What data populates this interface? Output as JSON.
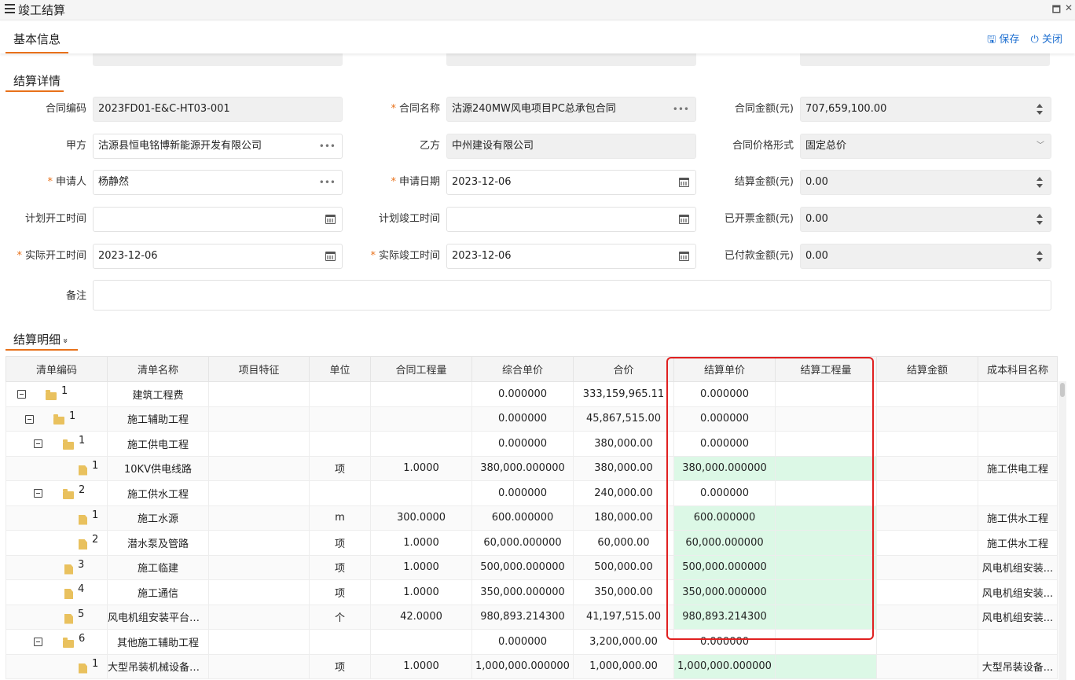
{
  "window": {
    "title": "竣工结算",
    "maximize_glyph": "🗖",
    "close_glyph": "✕"
  },
  "header": {
    "section": "基本信息",
    "save_label": "保存",
    "close_label": "关闭",
    "save_icon": "save-icon",
    "power_icon": "power-icon"
  },
  "details": {
    "section": "结算详情",
    "contract_code": {
      "label": "合同编码",
      "value": "2023FD01-E&C-HT03-001"
    },
    "contract_name": {
      "label": "合同名称",
      "value": "沽源240MW风电项目PC总承包合同"
    },
    "contract_amount": {
      "label": "合同金额(元)",
      "value": "707,659,100.00"
    },
    "party_a": {
      "label": "甲方",
      "value": "沽源县恒电铭博新能源开发有限公司"
    },
    "party_b": {
      "label": "乙方",
      "value": "中州建设有限公司"
    },
    "price_form": {
      "label": "合同价格形式",
      "value": "固定总价"
    },
    "applicant": {
      "label": "申请人",
      "value": "杨静然"
    },
    "apply_date": {
      "label": "申请日期",
      "value": "2023-12-06"
    },
    "settle_amount": {
      "label": "结算金额(元)",
      "value": "0.00"
    },
    "plan_start": {
      "label": "计划开工时间",
      "value": ""
    },
    "plan_end": {
      "label": "计划竣工时间",
      "value": ""
    },
    "invoiced_amount": {
      "label": "已开票金额(元)",
      "value": "0.00"
    },
    "actual_start": {
      "label": "实际开工时间",
      "value": "2023-12-06"
    },
    "actual_end": {
      "label": "实际竣工时间",
      "value": "2023-12-06"
    },
    "paid_amount": {
      "label": "已付款金额(元)",
      "value": "0.00"
    },
    "remark": {
      "label": "备注",
      "value": ""
    },
    "required_mark": "*",
    "dots": "•••"
  },
  "items": {
    "section": "结算明细",
    "chevron": "»",
    "columns": [
      "清单编码",
      "清单名称",
      "项目特征",
      "单位",
      "合同工程量",
      "综合单价",
      "合价",
      "结算单价",
      "结算工程量",
      "结算金额",
      "成本科目名称"
    ],
    "rows": [
      {
        "code": "1",
        "name": "建筑工程费",
        "feature": "",
        "unit": "",
        "qty": "",
        "price": "0.000000",
        "total": "333,159,965.11",
        "sprice": "0.000000",
        "sqty": "",
        "samt": "",
        "cost": ""
      },
      {
        "code": "1",
        "name": "施工辅助工程",
        "feature": "",
        "unit": "",
        "qty": "",
        "price": "0.000000",
        "total": "45,867,515.00",
        "sprice": "0.000000",
        "sqty": "",
        "samt": "",
        "cost": ""
      },
      {
        "code": "1",
        "name": "施工供电工程",
        "feature": "",
        "unit": "",
        "qty": "",
        "price": "0.000000",
        "total": "380,000.00",
        "sprice": "0.000000",
        "sqty": "",
        "samt": "",
        "cost": ""
      },
      {
        "code": "1",
        "name": "10KV供电线路",
        "feature": "",
        "unit": "项",
        "qty": "1.0000",
        "price": "380,000.000000",
        "total": "380,000.00",
        "sprice": "380,000.000000",
        "sqty": "",
        "samt": "",
        "cost": "施工供电工程"
      },
      {
        "code": "2",
        "name": "施工供水工程",
        "feature": "",
        "unit": "",
        "qty": "",
        "price": "0.000000",
        "total": "240,000.00",
        "sprice": "0.000000",
        "sqty": "",
        "samt": "",
        "cost": ""
      },
      {
        "code": "1",
        "name": "施工水源",
        "feature": "",
        "unit": "m",
        "qty": "300.0000",
        "price": "600.000000",
        "total": "180,000.00",
        "sprice": "600.000000",
        "sqty": "",
        "samt": "",
        "cost": "施工供水工程"
      },
      {
        "code": "2",
        "name": "潜水泵及管路",
        "feature": "",
        "unit": "项",
        "qty": "1.0000",
        "price": "60,000.000000",
        "total": "60,000.00",
        "sprice": "60,000.000000",
        "sqty": "",
        "samt": "",
        "cost": "施工供水工程"
      },
      {
        "code": "3",
        "name": "施工临建",
        "feature": "",
        "unit": "项",
        "qty": "1.0000",
        "price": "500,000.000000",
        "total": "500,000.00",
        "sprice": "500,000.000000",
        "sqty": "",
        "samt": "",
        "cost": "风电机组安装..."
      },
      {
        "code": "4",
        "name": "施工通信",
        "feature": "",
        "unit": "项",
        "qty": "1.0000",
        "price": "350,000.000000",
        "total": "350,000.00",
        "sprice": "350,000.000000",
        "sqty": "",
        "samt": "",
        "cost": "风电机组安装..."
      },
      {
        "code": "5",
        "name": "风电机组安装平台工...",
        "feature": "",
        "unit": "个",
        "qty": "42.0000",
        "price": "980,893.214300",
        "total": "41,197,515.00",
        "sprice": "980,893.214300",
        "sqty": "",
        "samt": "",
        "cost": "风电机组安装..."
      },
      {
        "code": "6",
        "name": "其他施工辅助工程",
        "feature": "",
        "unit": "",
        "qty": "",
        "price": "0.000000",
        "total": "3,200,000.00",
        "sprice": "0.000000",
        "sqty": "",
        "samt": "",
        "cost": ""
      },
      {
        "code": "1",
        "name": "大型吊装机械设备进...",
        "feature": "",
        "unit": "项",
        "qty": "1.0000",
        "price": "1,000,000.000000",
        "total": "1,000,000.00",
        "sprice": "1,000,000.000000",
        "sqty": "",
        "samt": "",
        "cost": "大型吊装设备..."
      }
    ]
  }
}
